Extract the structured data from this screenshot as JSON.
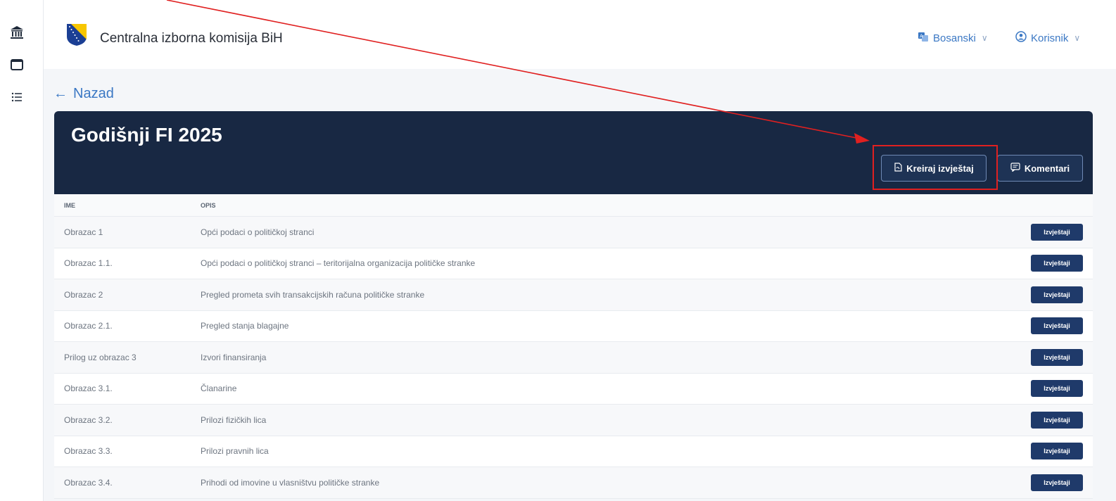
{
  "app": {
    "title": "Centralna izborna komisija BiH"
  },
  "topbar": {
    "language": "Bosanski",
    "user": "Korisnik"
  },
  "nav": {
    "back_label": "Nazad"
  },
  "page": {
    "title": "Godišnji FI 2025"
  },
  "actions": {
    "create_report": "Kreiraj izvještaj",
    "comments": "Komentari"
  },
  "table": {
    "headers": {
      "name": "IME",
      "description": "OPIS"
    },
    "row_action": "Izvještaji",
    "rows": [
      {
        "name": "Obrazac 1",
        "description": "Opći podaci o političkoj stranci"
      },
      {
        "name": "Obrazac 1.1.",
        "description": "Opći podaci o političkoj stranci – teritorijalna organizacija političke stranke"
      },
      {
        "name": "Obrazac 2",
        "description": "Pregled prometa svih transakcijskih računa političke stranke"
      },
      {
        "name": "Obrazac 2.1.",
        "description": "Pregled stanja blagajne"
      },
      {
        "name": "Prilog uz obrazac 3",
        "description": "Izvori finansiranja"
      },
      {
        "name": "Obrazac 3.1.",
        "description": "Članarine"
      },
      {
        "name": "Obrazac 3.2.",
        "description": "Prilozi fizičkih lica"
      },
      {
        "name": "Obrazac 3.3.",
        "description": "Prilozi pravnih lica"
      },
      {
        "name": "Obrazac 3.4.",
        "description": "Prihodi od imovine u vlasništvu političke stranke"
      }
    ]
  },
  "colors": {
    "header_bg": "#182843",
    "accent": "#3b78c4",
    "row_button": "#1f3a6a",
    "annotation": "#e02020"
  }
}
